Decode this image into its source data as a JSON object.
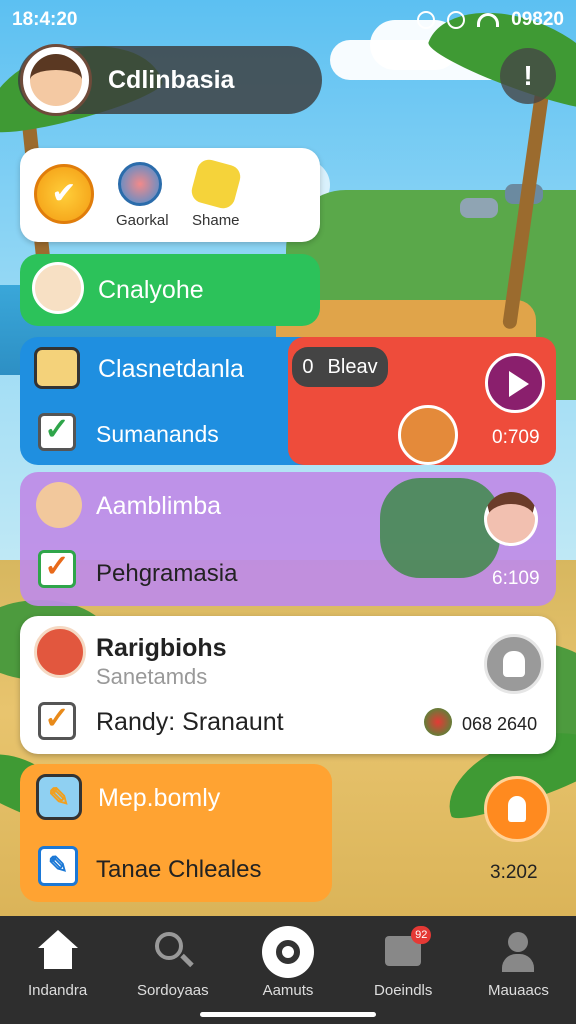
{
  "status_bar": {
    "time": "18:4:20",
    "right_text": "09820"
  },
  "profile": {
    "name": "Cdlinbasia"
  },
  "alert_button": {
    "label": "!"
  },
  "icon_card": {
    "items": [
      {
        "label": "Gaorkal"
      },
      {
        "label": "Shame"
      }
    ]
  },
  "green_card": {
    "title": "Cnalyohe"
  },
  "blue_card": {
    "title": "Clasnetdanla",
    "subtitle": "Sumanands"
  },
  "red_card": {
    "chip_number": "0",
    "chip_label": "Bleav",
    "time": "0:709"
  },
  "purple_card": {
    "title": "Aamblimba",
    "subtitle": "Pehgramasia",
    "time": "6:109"
  },
  "white_card": {
    "title": "Rarigbiohs",
    "subtitle": "Sanetamds",
    "line": "Randy: Sranaunt",
    "number": "068 2640"
  },
  "orange_card": {
    "title": "Mep.bomly",
    "subtitle": "Tanae Chleales",
    "time": "3:202"
  },
  "bottom_nav": {
    "items": [
      {
        "label": "Indandra"
      },
      {
        "label": "Sordoyaas"
      },
      {
        "label": "Aamuts"
      },
      {
        "label": "Doeindls",
        "badge": "92"
      },
      {
        "label": "Mauaacs"
      }
    ]
  },
  "colors": {
    "green": "#2cc25a",
    "blue": "#1f8fe0",
    "red": "#ee4c3b",
    "purple": "#be8ce6",
    "orange": "#ffa332",
    "nav": "#2e2e2e"
  }
}
